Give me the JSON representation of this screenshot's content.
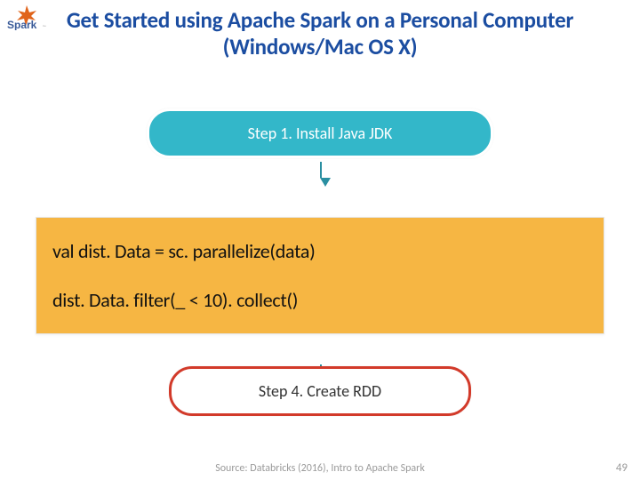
{
  "logo": {
    "name": "Spark",
    "primary": "#e0641b",
    "accent": "#3a5b99"
  },
  "title": "Get Started using Apache Spark on a Personal Computer (Windows/Mac OS X)",
  "steps": [
    {
      "label": "Step 1. Install Java JDK",
      "style": "solid"
    },
    {
      "label": "",
      "style": "hidden-behind-overlay"
    },
    {
      "label": "",
      "style": "hidden-behind-overlay"
    },
    {
      "label": "Step 4. Create RDD",
      "style": "final"
    }
  ],
  "code": {
    "line1": "val dist. Data = sc. parallelize(data)",
    "line2": "dist. Data. filter(_ < 10). collect()"
  },
  "source": "Source: Databricks (2016), Intro to Apache Spark",
  "page_number": "49"
}
